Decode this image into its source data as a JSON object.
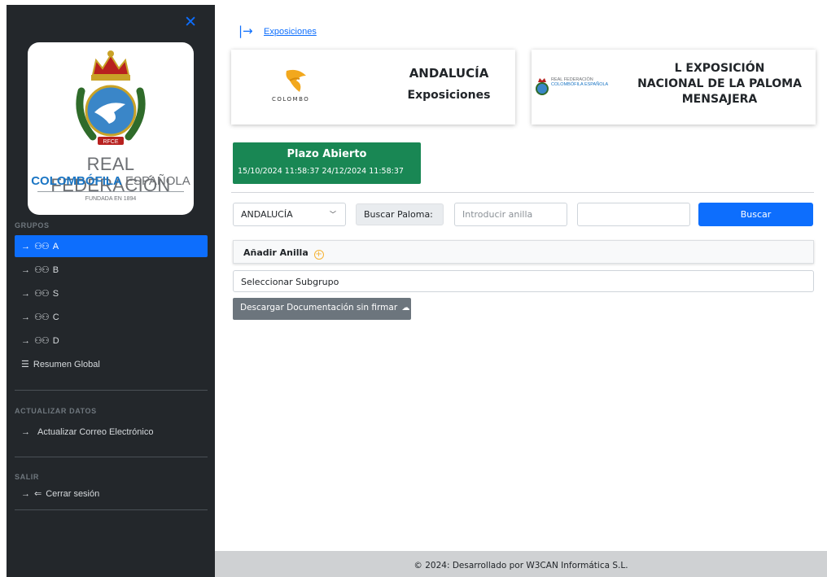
{
  "sidebar": {
    "close_symbol": "✕",
    "logo": {
      "line1": "REAL FEDERACIÓN",
      "line2_bold": "COLOMBÓFILA",
      "line2_rest": " ESPAÑOLA",
      "line3": "FUNDADA EN 1894",
      "badge": "RFCE"
    },
    "sections": {
      "grupos": "GRUPOS",
      "actualizar": "ACTUALIZAR DATOS",
      "salir": "SALIR"
    },
    "groups": [
      {
        "label": "A",
        "active": true
      },
      {
        "label": "B",
        "active": false
      },
      {
        "label": "S",
        "active": false
      },
      {
        "label": "C",
        "active": false
      },
      {
        "label": "D",
        "active": false
      }
    ],
    "resumen": "Resumen Global",
    "update_email": "Actualizar Correo Electrónico",
    "logout": "Cerrar sesión"
  },
  "breadcrumb": {
    "label": "Exposiciones"
  },
  "card_left": {
    "brand": "COLOMBO",
    "title": "ANDALUCÍA",
    "subtitle": "Exposiciones"
  },
  "card_right": {
    "logo_text_1": "REAL FEDERACIÓN",
    "logo_text_2": "COLOMBÓFILA ESPAÑOLA",
    "title_line1": "L EXPOSICIÓN",
    "title_line2": "NACIONAL DE LA PALOMA",
    "title_line3": "MENSAJERA"
  },
  "plazo": {
    "title": "Plazo Abierto",
    "dates": "15/10/2024 11:58:37 24/12/2024 11:58:37"
  },
  "search": {
    "region_selected": "ANDALUCÍA",
    "label": "Buscar Paloma:",
    "anilla_placeholder": "Introducir anilla",
    "button": "Buscar"
  },
  "anadir": {
    "label": "Añadir Anilla"
  },
  "subgrupo": {
    "label": "Seleccionar Subgrupo"
  },
  "descargar": {
    "label": "Descargar Documentación sin firmar"
  },
  "footer": {
    "text": "© 2024: Desarrollado por W3CAN Informática S.L."
  },
  "colors": {
    "primary": "#0d6efd",
    "success": "#198754",
    "secondary": "#6c757d",
    "sidebar_bg": "#23272b",
    "accent_plus": "#f5b335"
  }
}
